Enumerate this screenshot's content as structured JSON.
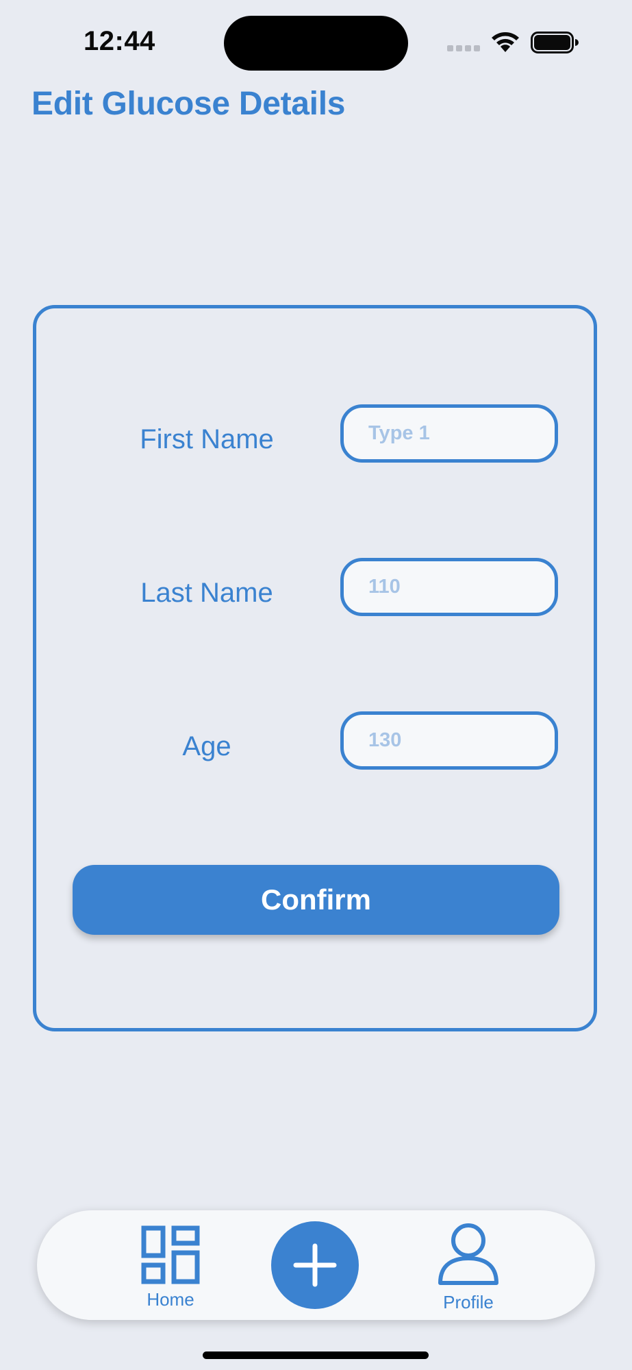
{
  "status_bar": {
    "time": "12:44"
  },
  "header": {
    "title": "Edit Glucose Details"
  },
  "form": {
    "fields": [
      {
        "label": "First Name",
        "placeholder": "Type 1",
        "value": ""
      },
      {
        "label": "Last Name",
        "placeholder": "110",
        "value": ""
      },
      {
        "label": "Age",
        "placeholder": "130",
        "value": ""
      }
    ],
    "confirm_label": "Confirm"
  },
  "tab_bar": {
    "home_label": "Home",
    "add_icon": "plus-icon",
    "profile_label": "Profile"
  },
  "colors": {
    "accent": "#3a82d0",
    "background": "#e8ebf2",
    "input_background": "#f6f8fa",
    "placeholder": "#a7c4e6"
  }
}
